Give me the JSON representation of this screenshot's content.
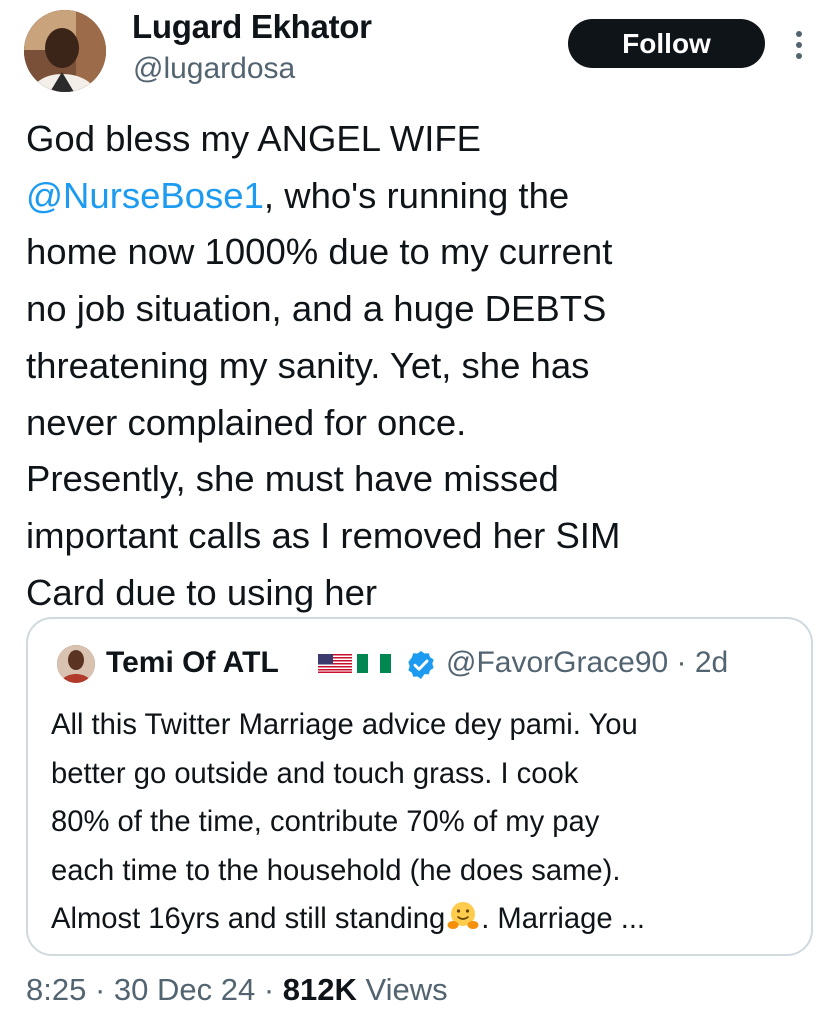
{
  "author": {
    "display_name": "Lugard Ekhator",
    "handle": "@lugardosa",
    "avatar_icon": "profile-photo"
  },
  "follow_label": "Follow",
  "more_icon": "more-vertical-icon",
  "tweet": {
    "line1": "God bless my ANGEL WIFE",
    "mention": "@NurseBose1",
    "line2_rest": ", who's running the",
    "line3": "home now 1000% due to my current",
    "line4": "no job situation, and a huge DEBTS",
    "line5": "threatening my sanity. Yet, she has",
    "line6": "never complained for once.",
    "line7": "Presently, she must have missed",
    "line8": "important calls as I removed her SIM",
    "line9": "Card due to using her"
  },
  "quote": {
    "display_name": "Temi Of ATL",
    "flags": [
      "us-flag",
      "nigeria-flag"
    ],
    "verified_icon": "verified-badge-icon",
    "handle_time": "@FavorGrace90 · 2d",
    "line1": "All this Twitter Marriage advice dey pami. You",
    "line2": "better go outside and touch grass. I cook",
    "line3": "80% of the time, contribute 70% of my pay",
    "line4": "each time to the household (he does same).",
    "line5_a": "Almost 16yrs and still standing",
    "line5_emoji": "hugging-face-emoji",
    "line5_b": ". Marriage ..."
  },
  "meta": {
    "time_date": "8:25 · 30 Dec 24 · ",
    "views_count": "812K",
    "views_label": " Views"
  },
  "colors": {
    "text": "#0f1419",
    "secondary": "#536471",
    "link": "#1d9bf0",
    "border": "#cfd9de",
    "button_bg": "#0f1419",
    "verified": "#1d9bf0"
  }
}
